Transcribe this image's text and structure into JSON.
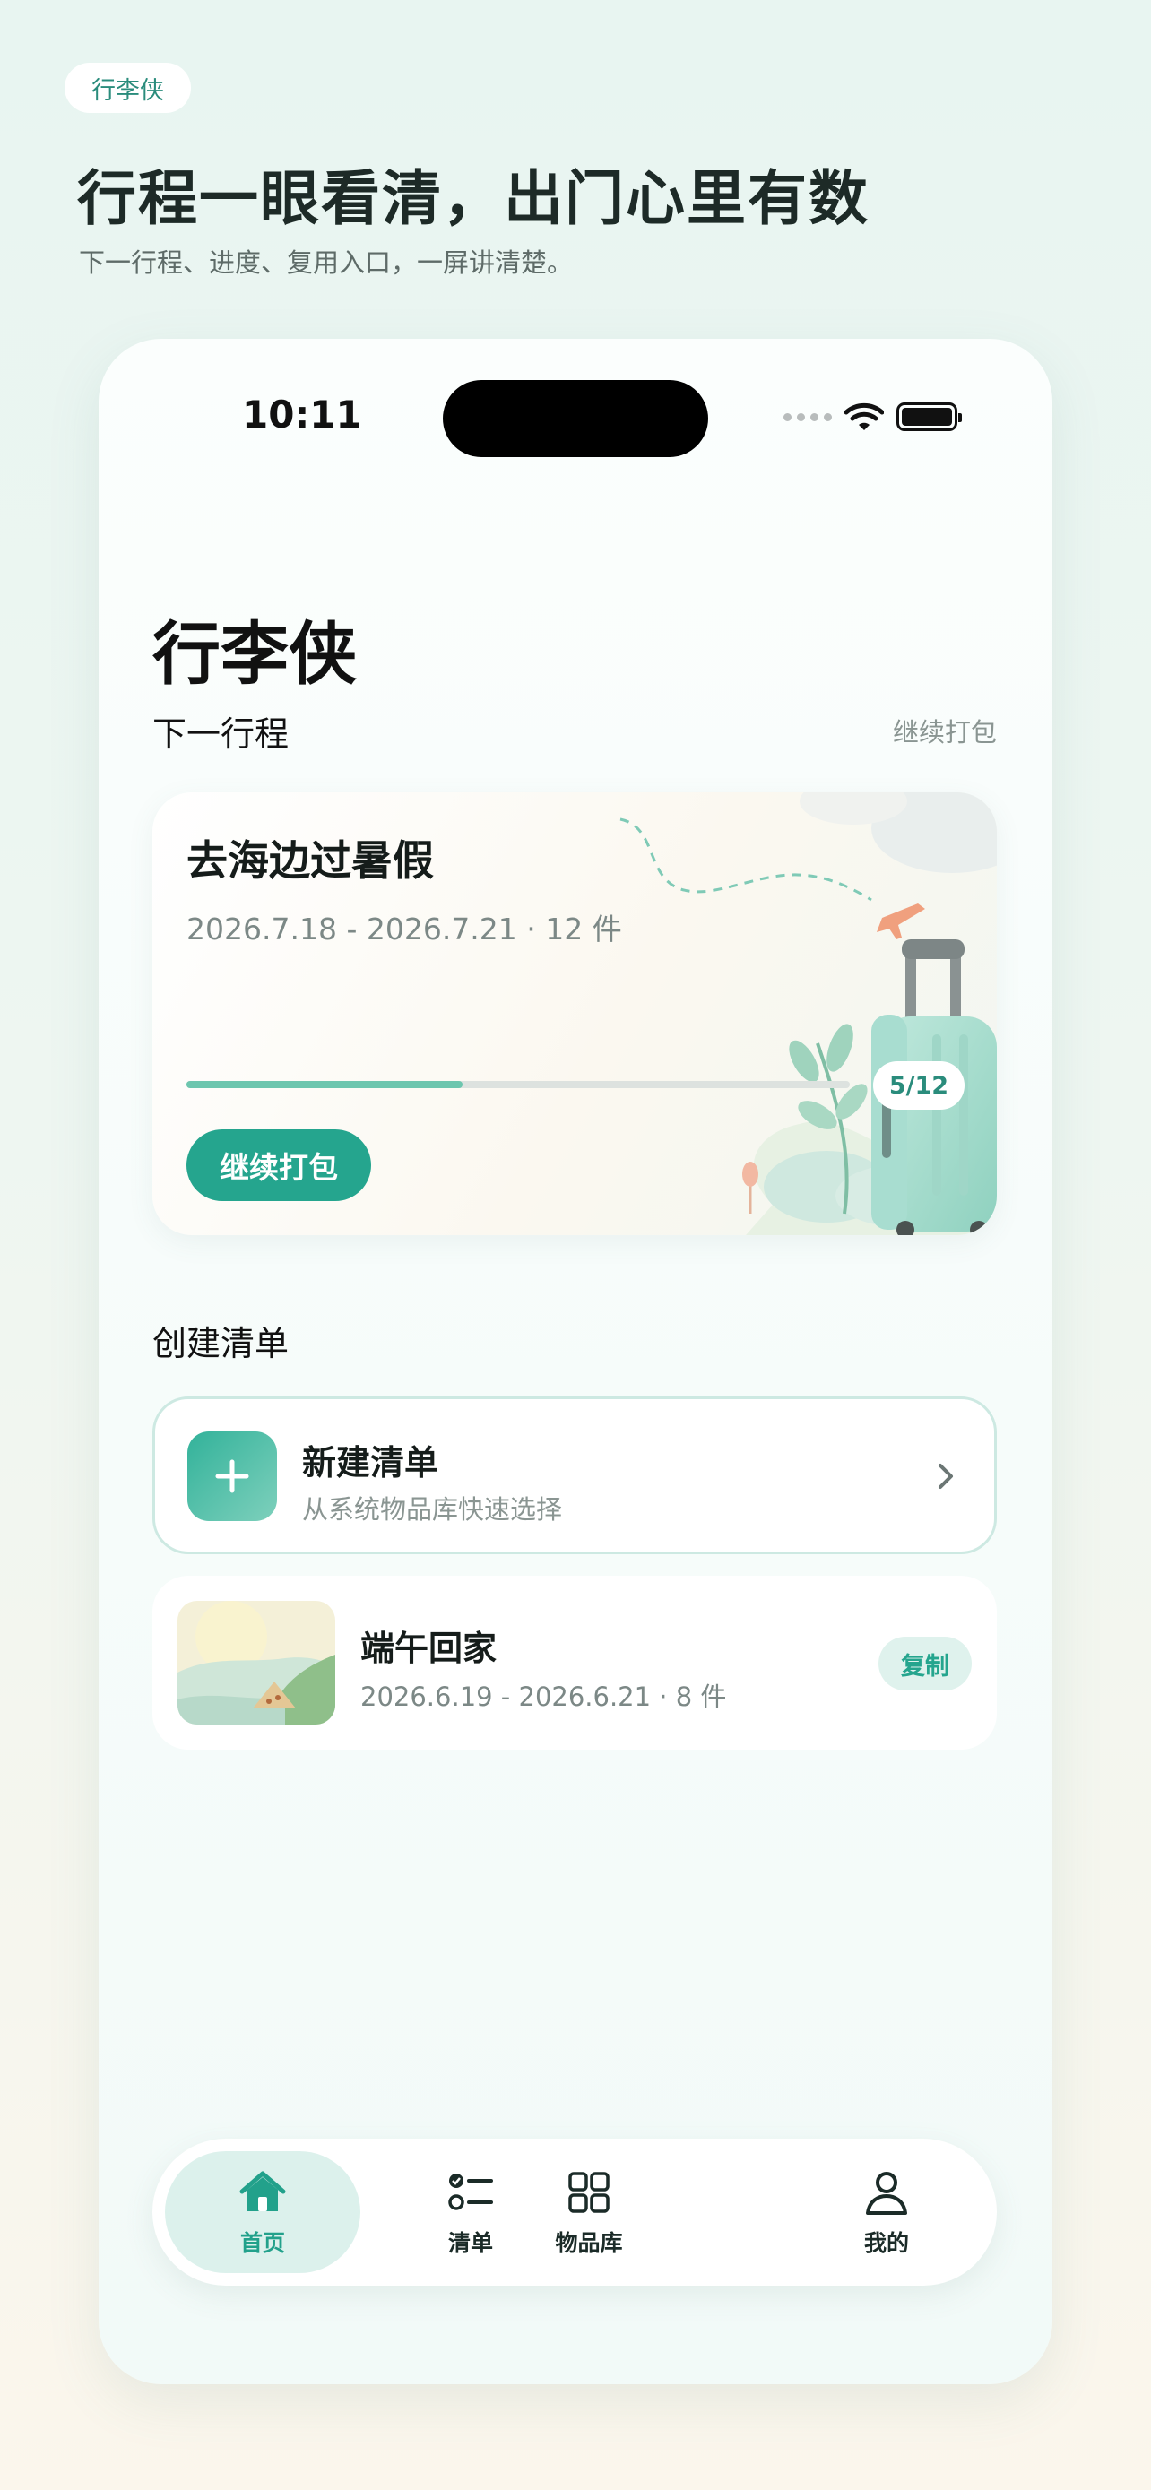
{
  "header": {
    "badge": "行李侠",
    "title": "行程一眼看清，出门心里有数",
    "subtitle": "下一行程、进度、复用入口，一屏讲清楚。"
  },
  "status_bar": {
    "time": "10:11"
  },
  "app": {
    "title": "行李侠",
    "next_section": "下一行程",
    "continue_link": "继续打包",
    "trip": {
      "name": "去海边过暑假",
      "meta": "2026.7.18 - 2026.7.21 · 12 件",
      "progress": 0.4167,
      "count": "5/12",
      "button": "继续打包"
    },
    "create_section": "创建清单",
    "new_list": {
      "title": "新建清单",
      "subtitle": "从系统物品库快速选择"
    },
    "recent": {
      "name": "端午回家",
      "meta": "2026.6.19 - 2026.6.21 · 8 件",
      "copy": "复制"
    }
  },
  "tabs": [
    {
      "label": "首页",
      "icon": "home-icon",
      "active": true
    },
    {
      "label": "清单",
      "icon": "checklist-icon",
      "active": false
    },
    {
      "label": "物品库",
      "icon": "grid-icon",
      "active": false
    },
    {
      "label": "我的",
      "icon": "user-icon",
      "active": false
    }
  ],
  "colors": {
    "accent": "#25a58e",
    "accent_light": "#dcf1ec",
    "progress": "#6dc6ae"
  }
}
